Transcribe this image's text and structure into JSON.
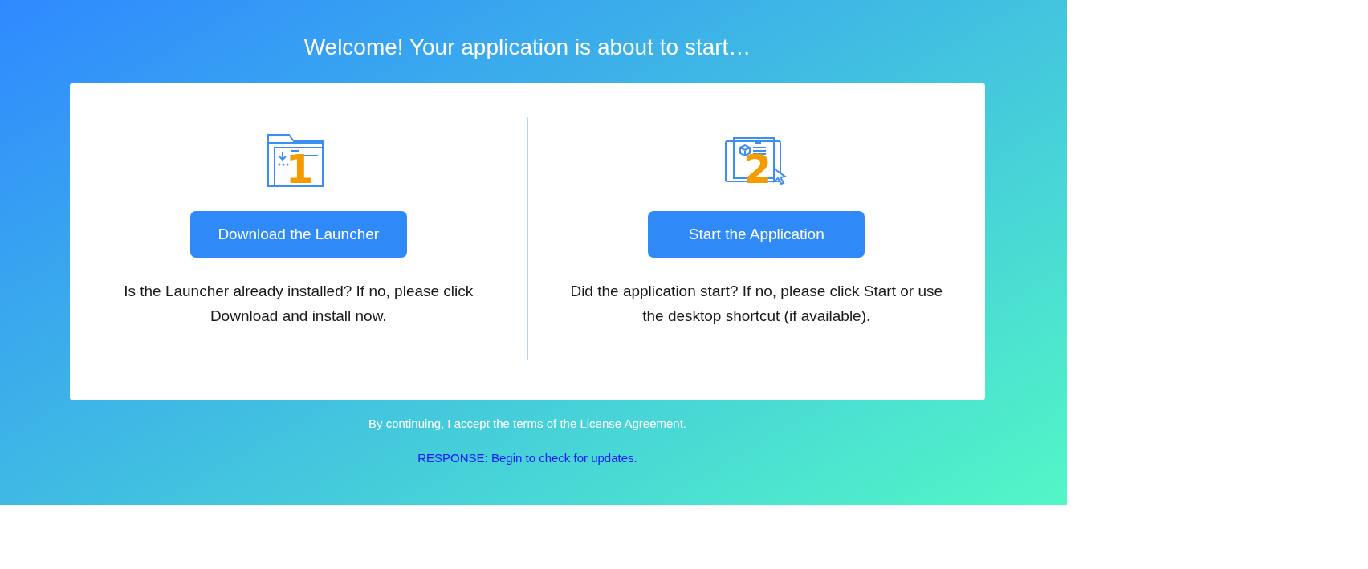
{
  "title": "Welcome! Your application is about to start…",
  "steps": [
    {
      "kind": "download",
      "step": "1",
      "button": "Download the Launcher",
      "description": "Is the Launcher already installed? If no, please click Download and install now."
    },
    {
      "kind": "start",
      "step": "2",
      "button": "Start the Application",
      "description": "Did the application start? If no, please click Start or use the desktop shortcut (if available)."
    }
  ],
  "terms": {
    "text": "By continuing, I accept the terms of the",
    "link": "License Agreement."
  },
  "response": "RESPONSE: Begin to check for updates."
}
